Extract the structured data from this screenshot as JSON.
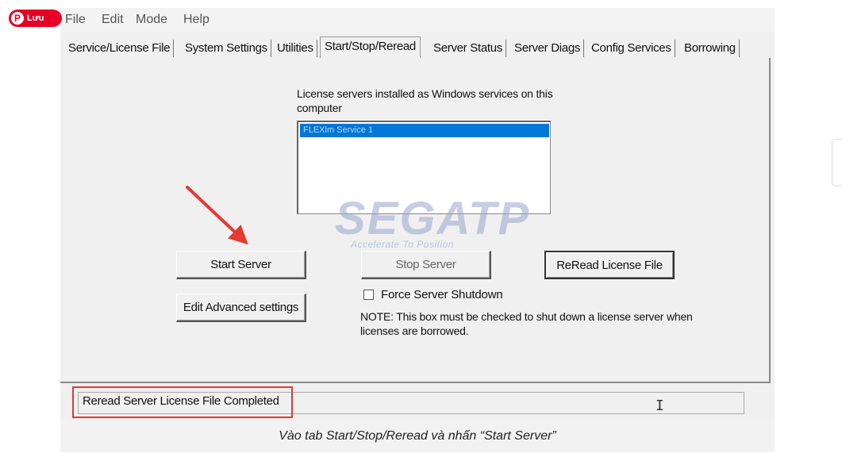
{
  "menu": {
    "file": "File",
    "edit": "Edit",
    "mode": "Mode",
    "help": "Help"
  },
  "pinterest": {
    "label": "Lưu",
    "icon": "pinterest-icon"
  },
  "tabs": [
    {
      "label": "Service/License File"
    },
    {
      "label": "System Settings"
    },
    {
      "label": "Utilities"
    },
    {
      "label": "Start/Stop/Reread"
    },
    {
      "label": "Server Status"
    },
    {
      "label": "Server Diags"
    },
    {
      "label": "Config Services"
    },
    {
      "label": "Borrowing"
    }
  ],
  "panel": {
    "list_label": "License servers installed as Windows services on this computer",
    "list_items": [
      {
        "label": "FLEXlm Service 1",
        "selected": true
      }
    ],
    "start_server": "Start Server",
    "stop_server": "Stop Server",
    "reread": "ReRead License File",
    "edit_advanced": "Edit Advanced settings",
    "force_shutdown": "Force Server Shutdown",
    "force_checked": false,
    "note": "NOTE:  This box must be checked to shut down a license server when licenses are borrowed."
  },
  "status": {
    "text": "Reread Server License File Completed"
  },
  "watermark": {
    "brand": "SEGATP",
    "tagline": "Accelerate To Position"
  },
  "caption": "Vào tab Start/Stop/Reread và nhấn “Start Server”",
  "colors": {
    "highlight": "#e53935",
    "selection": "#0078d7",
    "pinterest": "#e60023"
  }
}
